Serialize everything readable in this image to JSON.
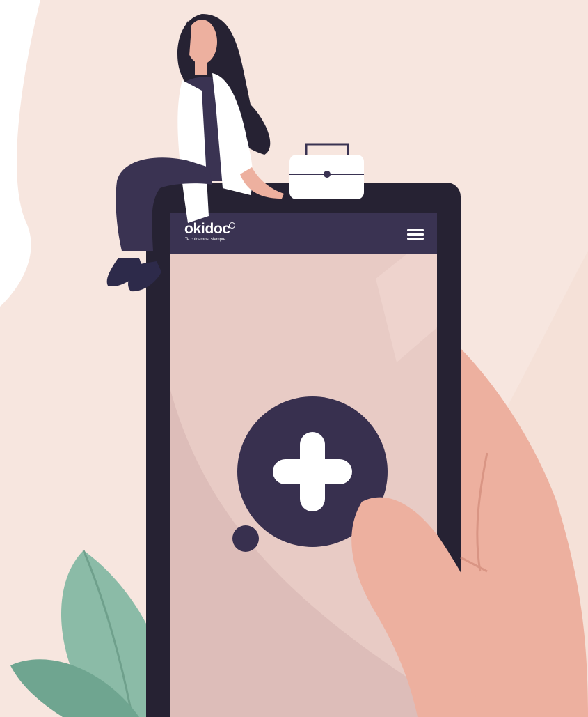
{
  "brand": {
    "name": "okidoc",
    "tagline": "Te cuidamos, siempre"
  },
  "header": {
    "menu_icon": "hamburger-menu-icon"
  },
  "main": {
    "action_icon": "plus-icon"
  },
  "colors": {
    "background": "#f7e6df",
    "phone_frame": "#262233",
    "header_bar": "#3a3352",
    "screen": "#e8cbc5",
    "accent": "#38304f",
    "skin": "#edb09f",
    "leaf": "#7fb59f"
  }
}
